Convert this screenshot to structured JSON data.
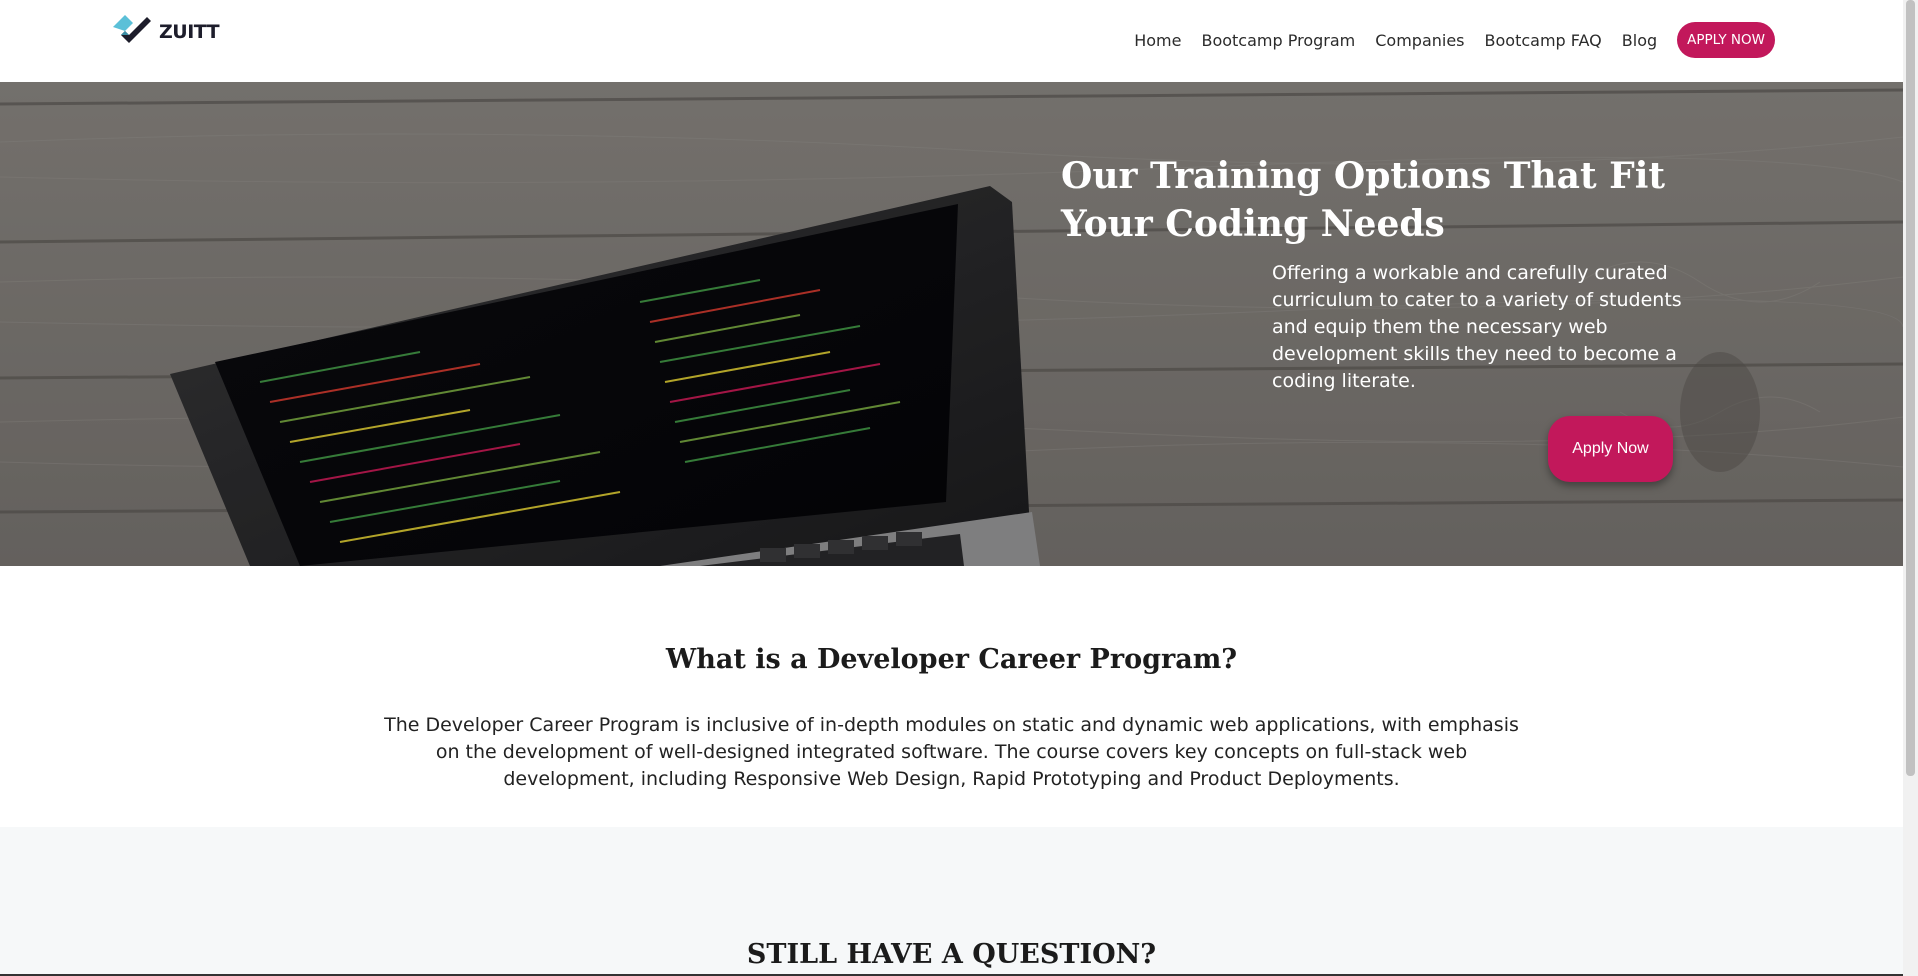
{
  "brand": {
    "name": "ZUITT",
    "logo_icon": "zuitt-logo-icon",
    "accent": "#5bc0d8"
  },
  "nav": {
    "links": [
      "Home",
      "Bootcamp Program",
      "Companies",
      "Bootcamp FAQ",
      "Blog"
    ],
    "cta": "APPLY NOW"
  },
  "hero": {
    "title": "Our Training Options That Fit Your Coding Needs",
    "text": "Offering a workable and carefully curated curriculum to cater to a variety of students and equip them the necessary web development skills they need to become a coding literate.",
    "cta": "Apply Now"
  },
  "info": {
    "title": "What is a Developer Career Program?",
    "text": "The Developer Career Program is inclusive of in-depth modules on static and dynamic web applications, with emphasis on the development of well-designed integrated software. The course covers key concepts on full-stack web development, including Responsive Web Design, Rapid Prototyping and Product Deployments."
  },
  "question": {
    "title": "STILL HAVE A QUESTION?"
  },
  "colors": {
    "primary": "#c2185b",
    "section_bg": "#f6f8f9"
  }
}
